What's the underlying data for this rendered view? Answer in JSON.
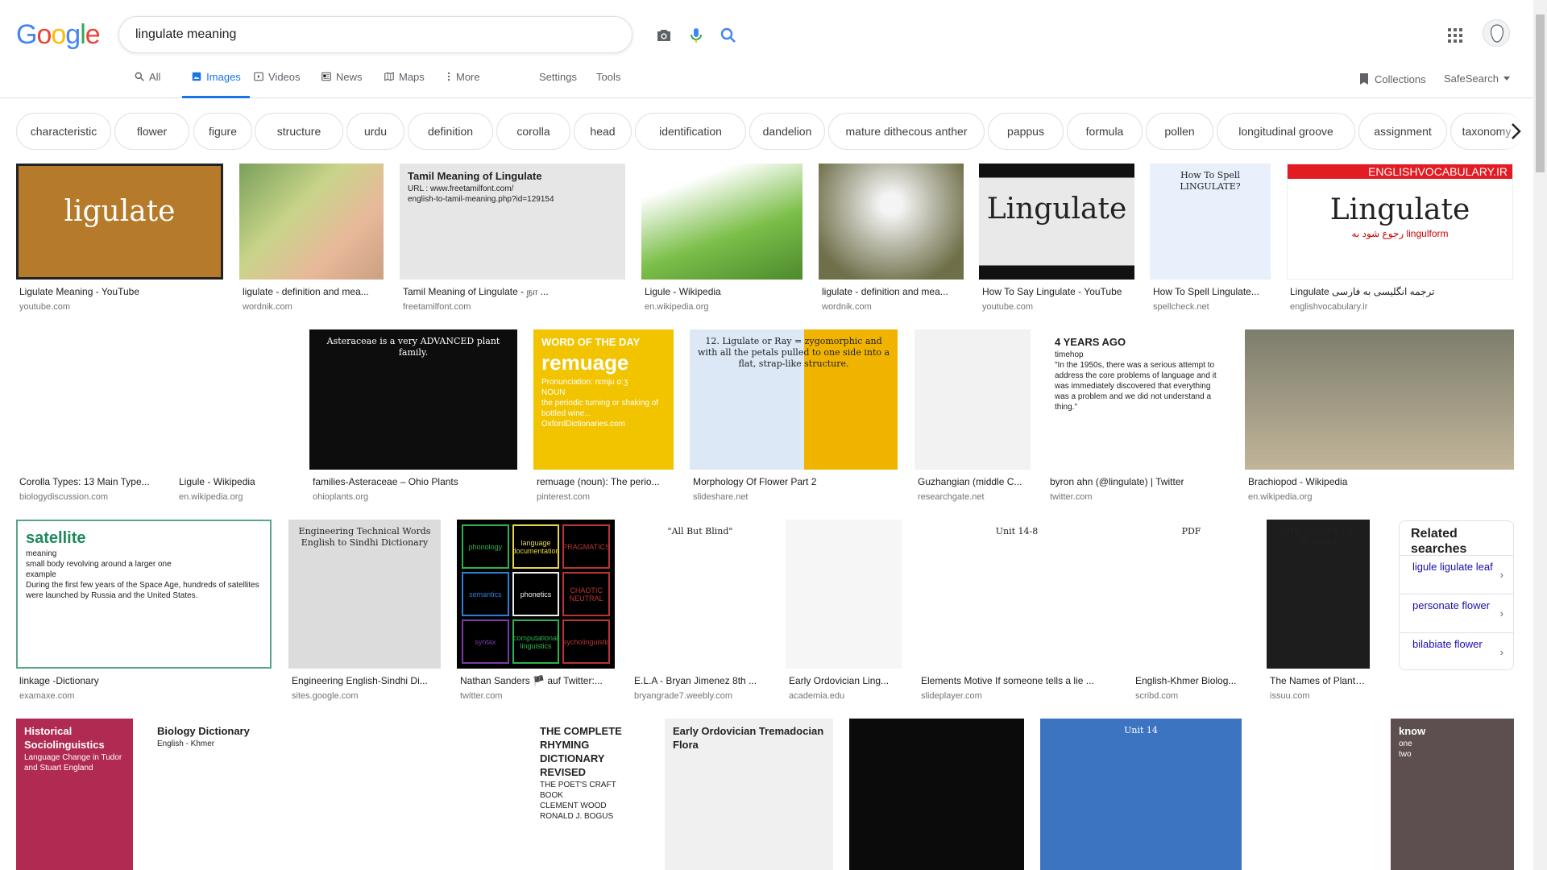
{
  "header": {
    "logo": [
      "G",
      "o",
      "o",
      "g",
      "l",
      "e"
    ],
    "logo_colors": [
      "#4285F4",
      "#EA4335",
      "#FBBC05",
      "#4285F4",
      "#34A853",
      "#EA4335"
    ],
    "search_value": "lingulate meaning"
  },
  "tabs": [
    {
      "label": "All",
      "icon": "search-icon"
    },
    {
      "label": "Images",
      "icon": "image-icon"
    },
    {
      "label": "Videos",
      "icon": "video-icon"
    },
    {
      "label": "News",
      "icon": "news-icon"
    },
    {
      "label": "Maps",
      "icon": "maps-icon"
    },
    {
      "label": "More",
      "icon": "more-vert-icon"
    },
    {
      "label": "Settings"
    },
    {
      "label": "Tools"
    }
  ],
  "right_tools": {
    "collections": "Collections",
    "safesearch": "SafeSearch"
  },
  "chips": [
    "characteristic",
    "flower",
    "figure",
    "structure",
    "urdu",
    "definition",
    "corolla",
    "head",
    "identification",
    "dandelion",
    "mature dithecous anther",
    "pappus",
    "formula",
    "pollen",
    "longitudinal groove",
    "assignment",
    "taxonomy"
  ],
  "row1": [
    {
      "title": "Ligulate Meaning - YouTube",
      "source": "youtube.com",
      "thumb_text": "ligulate"
    },
    {
      "title": "ligulate - definition and mea...",
      "source": "wordnik.com"
    },
    {
      "title": "Tamil Meaning of Lingulate - நா ...",
      "source": "freetamilfont.com",
      "thumb_lines": [
        "Tamil Meaning of Lingulate",
        "URL : www.freetamilfont.com/",
        "english-to-tamil-meaning.php?id=129154"
      ]
    },
    {
      "title": "Ligule - Wikipedia",
      "source": "en.wikipedia.org"
    },
    {
      "title": "ligulate - definition and mea...",
      "source": "wordnik.com"
    },
    {
      "title": "How To Say Lingulate - YouTube",
      "source": "youtube.com",
      "thumb_text": "Lingulate"
    },
    {
      "title": "How To Spell Lingulate...",
      "source": "spellcheck.net",
      "thumb_text": "How To Spell LINGULATE?"
    },
    {
      "title": "Lingulate ترجمه انگلیسی به فارسی",
      "source": "englishvocabulary.ir",
      "thumb_banner": "ENGLISHVOCABULARY.IR",
      "thumb_text": "Lingulate",
      "thumb_sub": "رجوع شود به lingulform"
    }
  ],
  "row2": [
    {
      "title": "Corolla Types: 13 Main Type...",
      "source": "biologydiscussion.com"
    },
    {
      "title": "Ligule - Wikipedia",
      "source": "en.wikipedia.org"
    },
    {
      "title": "families-Asteraceae – Ohio Plants",
      "source": "ohioplants.org",
      "thumb_text": "Asteraceae is a very ADVANCED plant family."
    },
    {
      "title": "remuage (noun): The perio...",
      "source": "pinterest.com",
      "thumb_lines": [
        "WORD OF THE DAY",
        "remuage",
        "Pronunciation: rɛmju ɑːʒ",
        "NOUN",
        "the periodic turning or shaking of bottled wine...",
        "OxfordDictionaries.com"
      ]
    },
    {
      "title": "Morphology Of Flower Part 2",
      "source": "slideshare.net",
      "thumb_text": "12. Ligulate or Ray = zygomorphic and with all the petals pulled to one side into a flat, strap-like structure."
    },
    {
      "title": "Guzhangian (middle C...",
      "source": "researchgate.net"
    },
    {
      "title": "byron ahn (@lingulate) | Twitter",
      "source": "twitter.com",
      "thumb_lines": [
        "4 YEARS AGO",
        "timehop",
        "\"In the 1950s, there was a serious attempt to address the core problems of language and it was immediately discovered that everything was a problem and we did not understand a thing.\""
      ]
    },
    {
      "title": "Brachiopod - Wikipedia",
      "source": "en.wikipedia.org"
    }
  ],
  "row3": [
    {
      "title": "linkage -Dictionary",
      "source": "examaxe.com",
      "thumb_lines": [
        "satellite",
        "meaning",
        "small body revolving around a larger one",
        "example",
        "During the first few years of the Space Age, hundreds of satellites were launched by Russia and the United States."
      ]
    },
    {
      "title": "Engineering English-Sindhi Di...",
      "source": "sites.google.com",
      "thumb_text": "Engineering Technical Words English to Sindhi Dictionary"
    },
    {
      "title": "Nathan Sanders 🏴 auf Twitter:...",
      "source": "twitter.com",
      "thumb_cells": [
        "phonology",
        "language documentation",
        "PRAGMATICS",
        "semantics",
        "phonetics",
        "CHAOTIC NEUTRAL",
        "syntax",
        "computational linguistics",
        "psycholinguistics"
      ]
    },
    {
      "title": "E.L.A - Bryan Jimenez 8th ...",
      "source": "bryangrade7.weebly.com",
      "thumb_text": "\"All But Blind\""
    },
    {
      "title": "Early Ordovician Ling...",
      "source": "academia.edu"
    },
    {
      "title": "Elements Motive If someone tells a lie ...",
      "source": "slideplayer.com",
      "thumb_text": "Unit 14-8"
    },
    {
      "title": "English-Khmer Biolog...",
      "source": "scribd.com",
      "thumb_text": "PDF"
    },
    {
      "title": "The Names of Plants ...",
      "source": "issuu.com",
      "thumb_text": "THE NAMES OF PLANTS"
    }
  ],
  "related": {
    "title": "Related searches",
    "items": [
      "ligule ligulate leaf",
      "personate flower",
      "bilabiate flower"
    ]
  },
  "row4": [
    {
      "thumb_lines": [
        "Historical Sociolinguistics",
        "Language Change in Tudor and Stuart England"
      ]
    },
    {
      "thumb_lines": [
        "Biology Dictionary",
        "English - Khmer"
      ]
    },
    {},
    {
      "thumb_lines": [
        "THE COMPLETE RHYMING DICTIONARY REVISED",
        "THE POET'S CRAFT BOOK",
        "CLEMENT WOOD",
        "RONALD J. BOGUS"
      ]
    },
    {
      "thumb_lines": [
        "Early Ordovician Tremadocian Flora"
      ]
    },
    {},
    {
      "thumb_text": "Unit 14"
    },
    {},
    {
      "thumb_lines": [
        "know",
        "one",
        "two"
      ]
    }
  ],
  "colors": {
    "accent": "#1a73e8",
    "link": "#1a0dab",
    "muted": "#70757a"
  }
}
